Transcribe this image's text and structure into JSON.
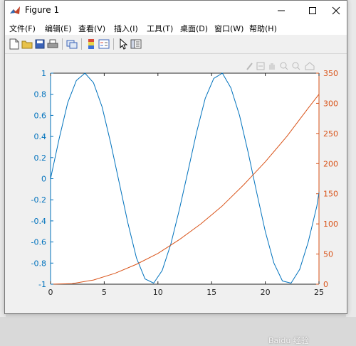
{
  "window": {
    "title": "Figure 1",
    "controls": {
      "minimize": "—",
      "maximize": "☐",
      "close": "✕"
    }
  },
  "menubar": {
    "items": [
      "文件(F)",
      "编辑(E)",
      "查看(V)",
      "插入(I)",
      "工具(T)",
      "桌面(D)",
      "窗口(W)",
      "帮助(H)"
    ]
  },
  "toolbar": {
    "buttons": [
      "new-figure-icon",
      "open-file-icon",
      "save-icon",
      "print-icon",
      "link-icon",
      "colorbar-icon",
      "legend-icon",
      "pointer-icon",
      "property-editor-icon"
    ]
  },
  "axes_toolbar": {
    "buttons": [
      "brush-icon",
      "data-cursor-icon",
      "pan-icon",
      "zoom-in-icon",
      "zoom-out-icon",
      "home-icon"
    ]
  },
  "watermark": "Baidu 经验",
  "colors": {
    "left_axis": "#0072BD",
    "right_axis": "#D95319"
  },
  "chart_data": {
    "type": "line",
    "title": "",
    "xlabel": "",
    "xlim": [
      0,
      25
    ],
    "xticks": [
      "0",
      "5",
      "10",
      "15",
      "20",
      "25"
    ],
    "y_left": {
      "ylim": [
        -1,
        1
      ],
      "ticks": [
        "1",
        "0.8",
        "0.6",
        "0.4",
        "0.2",
        "0",
        "-0.2",
        "-0.4",
        "-0.6",
        "-0.8",
        "-1"
      ],
      "color": "#0072BD"
    },
    "y_right": {
      "ylim": [
        0,
        350
      ],
      "ticks": [
        "350",
        "300",
        "250",
        "200",
        "150",
        "100",
        "50",
        "0"
      ],
      "color": "#D95319"
    },
    "series": [
      {
        "axis": "left",
        "color": "#0072BD",
        "x": [
          0,
          0.8,
          1.6,
          2.4,
          3.2,
          4.0,
          4.8,
          5.6,
          6.4,
          7.2,
          8.0,
          8.8,
          9.6,
          10.4,
          11.2,
          12.0,
          12.8,
          13.6,
          14.4,
          15.2,
          16.0,
          16.8,
          17.6,
          18.4,
          19.2,
          20.0,
          20.8,
          21.6,
          22.4,
          23.2,
          24.0,
          24.8,
          25.0
        ],
        "y": [
          0.0,
          0.38,
          0.72,
          0.93,
          1.0,
          0.91,
          0.68,
          0.34,
          -0.04,
          -0.42,
          -0.75,
          -0.95,
          -0.99,
          -0.87,
          -0.62,
          -0.29,
          0.07,
          0.44,
          0.76,
          0.95,
          1.0,
          0.86,
          0.6,
          0.25,
          -0.13,
          -0.5,
          -0.8,
          -0.97,
          -0.99,
          -0.86,
          -0.6,
          -0.26,
          -0.13
        ]
      },
      {
        "axis": "right",
        "color": "#D95319",
        "x": [
          0,
          2,
          4,
          6,
          8,
          10,
          12,
          14,
          16,
          18,
          20,
          22,
          24,
          25
        ],
        "y": [
          0,
          1,
          7,
          18,
          33,
          51,
          74,
          100,
          130,
          165,
          203,
          245,
          292,
          315
        ]
      }
    ]
  }
}
